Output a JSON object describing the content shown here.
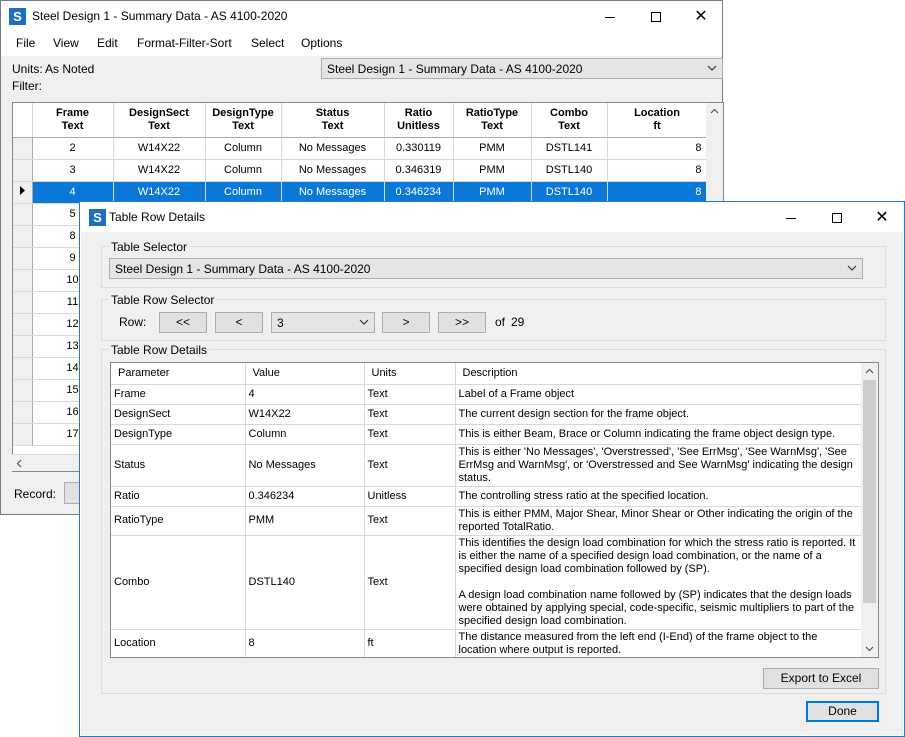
{
  "back": {
    "title": "Steel Design 1 - Summary Data - AS 4100-2020",
    "menu": [
      "File",
      "View",
      "Edit",
      "Format-Filter-Sort",
      "Select",
      "Options"
    ],
    "units_label": "Units:",
    "units_value": "As Noted",
    "filter_label": "Filter:",
    "table_select": "Steel Design 1 - Summary Data - AS 4100-2020",
    "columns": [
      {
        "l1": "Frame",
        "l2": "Text"
      },
      {
        "l1": "DesignSect",
        "l2": "Text"
      },
      {
        "l1": "DesignType",
        "l2": "Text"
      },
      {
        "l1": "Status",
        "l2": "Text"
      },
      {
        "l1": "Ratio",
        "l2": "Unitless"
      },
      {
        "l1": "RatioType",
        "l2": "Text"
      },
      {
        "l1": "Combo",
        "l2": "Text"
      },
      {
        "l1": "Location",
        "l2": "ft"
      }
    ],
    "rows": [
      [
        "2",
        "W14X22",
        "Column",
        "No Messages",
        "0.330119",
        "PMM",
        "DSTL141",
        "8"
      ],
      [
        "3",
        "W14X22",
        "Column",
        "No Messages",
        "0.346319",
        "PMM",
        "DSTL140",
        "8"
      ],
      [
        "4",
        "W14X22",
        "Column",
        "No Messages",
        "0.346234",
        "PMM",
        "DSTL140",
        "8"
      ],
      [
        "5",
        "",
        "",
        "",
        "",
        "",
        "",
        ""
      ],
      [
        "8",
        "",
        "",
        "",
        "",
        "",
        "",
        ""
      ],
      [
        "9",
        "",
        "",
        "",
        "",
        "",
        "",
        ""
      ],
      [
        "10",
        "",
        "",
        "",
        "",
        "",
        "",
        ""
      ],
      [
        "11",
        "",
        "",
        "",
        "",
        "",
        "",
        ""
      ],
      [
        "12",
        "",
        "",
        "",
        "",
        "",
        "",
        ""
      ],
      [
        "13",
        "",
        "",
        "",
        "",
        "",
        "",
        ""
      ],
      [
        "14",
        "",
        "",
        "",
        "",
        "",
        "",
        ""
      ],
      [
        "15",
        "",
        "",
        "",
        "",
        "",
        "",
        ""
      ],
      [
        "16",
        "",
        "",
        "",
        "",
        "",
        "",
        ""
      ],
      [
        "17",
        "",
        "",
        "",
        "",
        "",
        "",
        ""
      ]
    ],
    "selected_row_index": 2,
    "record_label": "Record:"
  },
  "front": {
    "title": "Table Row Details",
    "table_selector_label": "Table Selector",
    "table_selector_value": "Steel Design 1 - Summary Data - AS 4100-2020",
    "row_selector_label": "Table Row Selector",
    "row_label": "Row:",
    "first_btn": "<<",
    "prev_btn": "<",
    "row_value": "3",
    "next_btn": ">",
    "last_btn": ">>",
    "of_label": "of",
    "total_rows": "29",
    "details_label": "Table Row Details",
    "headers": [
      "Parameter",
      "Value",
      "Units",
      "Description"
    ],
    "details": [
      [
        "Frame",
        "4",
        "Text",
        "Label of a Frame object"
      ],
      [
        "DesignSect",
        "W14X22",
        "Text",
        "The current design section for the frame object."
      ],
      [
        "DesignType",
        "Column",
        "Text",
        "This is either Beam, Brace or Column indicating the frame object design type."
      ],
      [
        "Status",
        "No Messages",
        "Text",
        "This is either 'No Messages', 'Overstressed', 'See ErrMsg', 'See WarnMsg', 'See ErrMsg and WarnMsg', or 'Overstressed and See WarnMsg' indicating the design status."
      ],
      [
        "Ratio",
        "0.346234",
        "Unitless",
        "The controlling stress ratio at the specified location."
      ],
      [
        "RatioType",
        "PMM",
        "Text",
        "This is either PMM, Major Shear, Minor Shear or Other indicating the origin of the reported TotalRatio."
      ],
      [
        "Combo",
        "DSTL140",
        "Text",
        "This identifies the design load combination for which the stress ratio is reported.  It is either the name of a specified design load combination, or the name of a specified design load combination followed  by (SP).\n\nA design load combination name followed by (SP) indicates that the design loads were obtained by applying special, code-specific, seismic multipliers to part of the specified design load combination."
      ],
      [
        "Location",
        "8",
        "ft",
        "The distance measured from the left end (I-End) of the frame object to the location where output is reported."
      ]
    ],
    "export_btn": "Export to Excel",
    "done_btn": "Done"
  },
  "colors": {
    "selection": "#0a78d7",
    "app_icon": "#1e6fbf",
    "dialog_border": "#1f7ad2"
  }
}
